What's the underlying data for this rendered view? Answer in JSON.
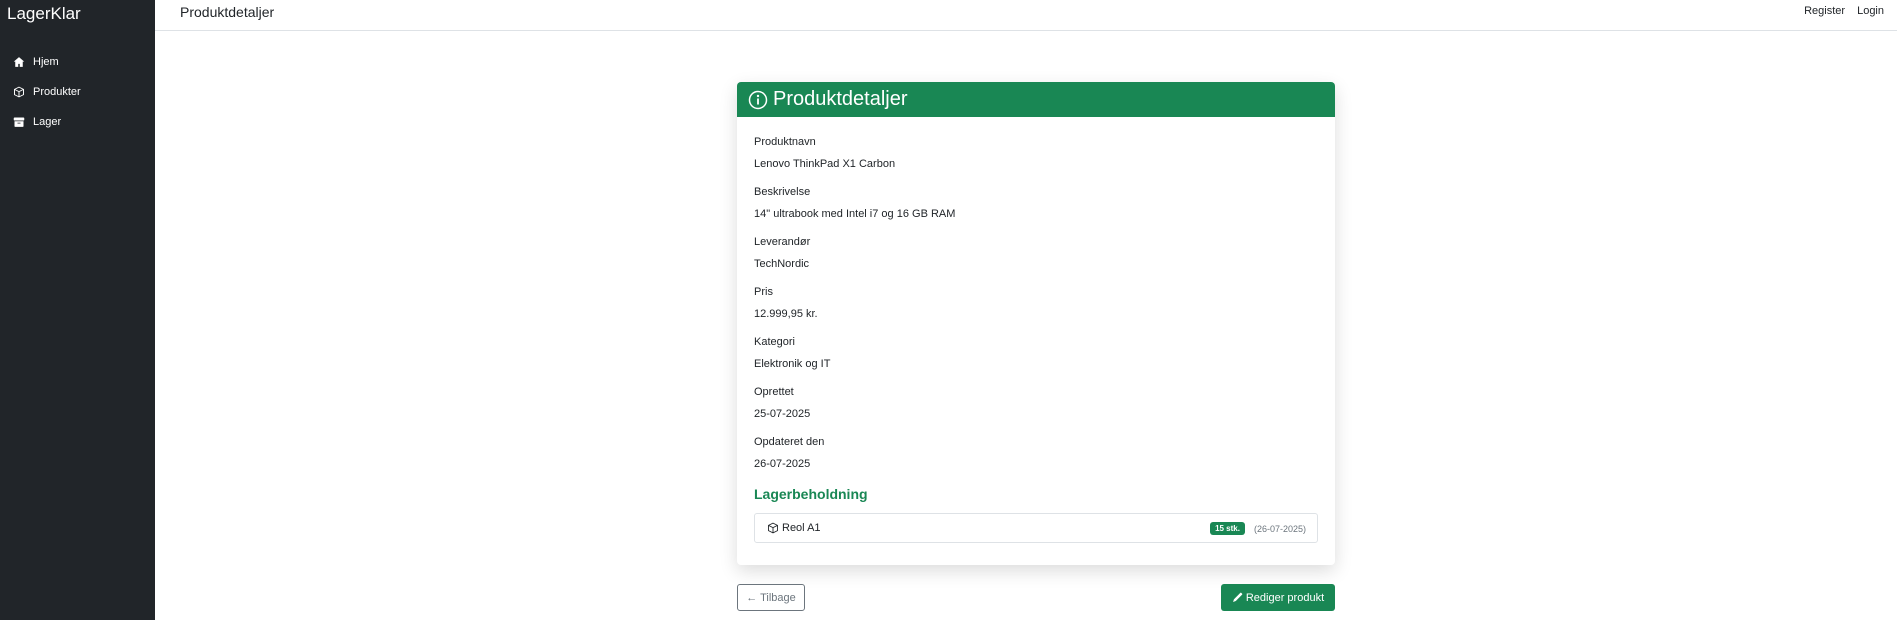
{
  "app": {
    "brand": "LagerKlar"
  },
  "sidebar": {
    "items": [
      {
        "label": "Hjem",
        "icon": "house-icon"
      },
      {
        "label": "Produkter",
        "icon": "box-icon"
      },
      {
        "label": "Lager",
        "icon": "archive-icon"
      }
    ]
  },
  "topbar": {
    "title": "Produktdetaljer",
    "register": "Register",
    "login": "Login"
  },
  "card": {
    "title": "Produktdetaljer",
    "header_color": "#198754",
    "fields": [
      {
        "label": "Produktnavn",
        "value": "Lenovo ThinkPad X1 Carbon"
      },
      {
        "label": "Beskrivelse",
        "value": "14\" ultrabook med Intel i7 og 16 GB RAM"
      },
      {
        "label": "Leverandør",
        "value": "TechNordic"
      },
      {
        "label": "Pris",
        "value": "12.999,95 kr."
      },
      {
        "label": "Kategori",
        "value": "Elektronik og IT"
      },
      {
        "label": "Oprettet",
        "value": "25-07-2025"
      },
      {
        "label": "Opdateret den",
        "value": "26-07-2025"
      }
    ],
    "stock": {
      "title": "Lagerbeholdning",
      "items": [
        {
          "location": "Reol A1",
          "quantity": "15 stk.",
          "date": "(26-07-2025)"
        }
      ]
    }
  },
  "actions": {
    "back": "← Tilbage",
    "edit": "Rediger produkt"
  }
}
